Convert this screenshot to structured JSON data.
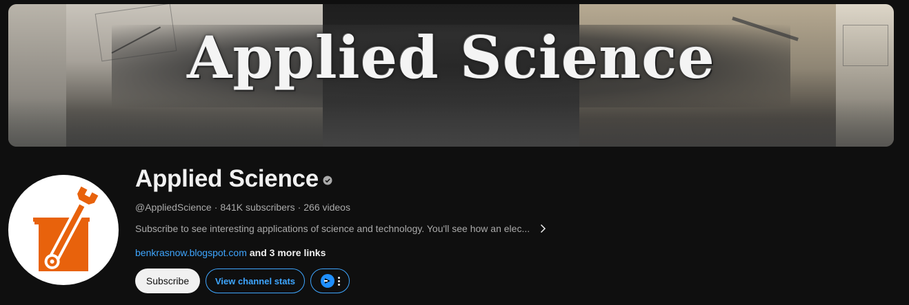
{
  "banner": {
    "title": "Applied Science"
  },
  "channel": {
    "name": "Applied Science",
    "handle": "@AppliedScience",
    "subscribers": "841K subscribers",
    "videos": "266 videos",
    "separator": "·",
    "description": "Subscribe to see interesting applications of science and technology. You'll see how an elec...",
    "link": "benkrasnow.blogspot.com",
    "more_links": "and 3 more links",
    "verified_icon": "verified-check-icon",
    "avatar_icon": "beaker-wrench-logo",
    "brand_color": "#e8620c"
  },
  "buttons": {
    "subscribe": "Subscribe",
    "view_stats": "View channel stats",
    "extension_icon": "extension-logo-icon",
    "more_icon": "kebab-menu-icon"
  },
  "colors": {
    "background": "#0f0f0f",
    "link": "#3ea6ff",
    "text_primary": "#f1f1f1",
    "text_secondary": "#aaaaaa"
  }
}
